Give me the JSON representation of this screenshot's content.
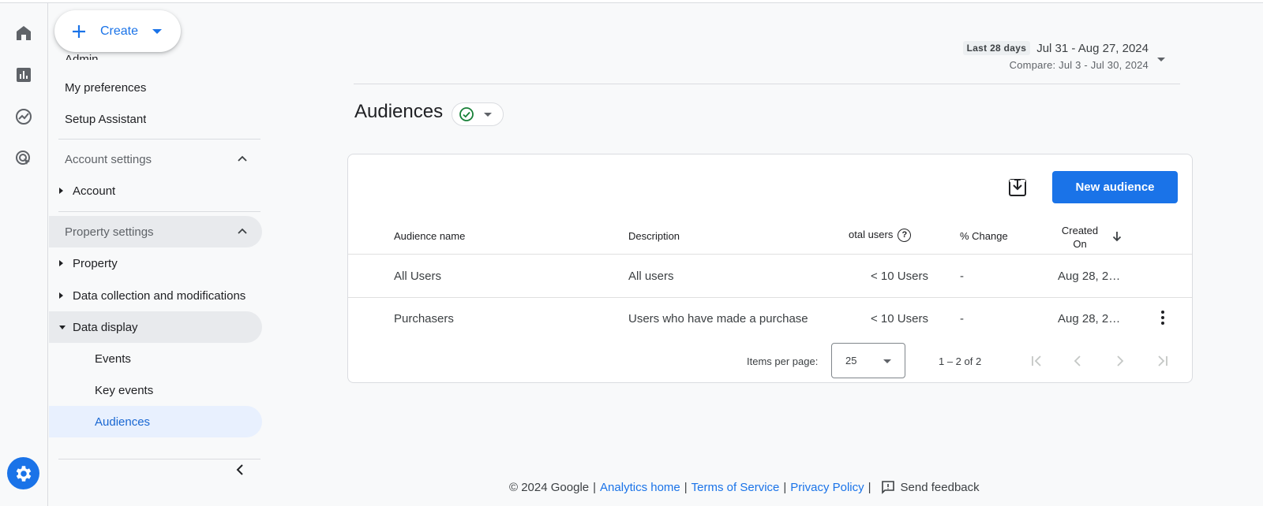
{
  "create": {
    "label": "Create"
  },
  "sidebar": {
    "admin_partial": "Admin",
    "my_preferences": "My preferences",
    "setup_assistant": "Setup Assistant",
    "account_settings": "Account settings",
    "account": "Account",
    "property_settings": "Property settings",
    "property": "Property",
    "data_collection": "Data collection and modifications",
    "data_display": "Data display",
    "events": "Events",
    "key_events": "Key events",
    "audiences": "Audiences"
  },
  "date": {
    "chip": "Last 28 days",
    "range": "Jul 31 - Aug 27, 2024",
    "compare": "Compare: Jul 3 - Jul 30, 2024"
  },
  "page": {
    "title": "Audiences"
  },
  "toolbar": {
    "new_audience": "New audience"
  },
  "table": {
    "headers": {
      "name": "Audience name",
      "description": "Description",
      "total_users": "otal users",
      "help": "?",
      "change": "% Change",
      "created_line1": "Created",
      "created_line2": "On"
    },
    "rows": [
      {
        "name": "All Users",
        "description": "All users",
        "users": "< 10 Users",
        "change": "-",
        "created": "Aug 28, 2…"
      },
      {
        "name": "Purchasers",
        "description": "Users who have made a purchase",
        "users": "< 10 Users",
        "change": "-",
        "created": "Aug 28, 2…"
      }
    ]
  },
  "pagination": {
    "items_per_page_label": "Items per page:",
    "items_per_page": "25",
    "range": "1 – 2 of 2"
  },
  "footer": {
    "copyright": "© 2024 Google",
    "analytics_home": "Analytics home",
    "terms": "Terms of Service",
    "privacy": "Privacy Policy",
    "feedback": "Send feedback"
  },
  "colors": {
    "accent": "#1a73e8",
    "selected_bg": "#e8f0fe",
    "success": "#188038"
  }
}
